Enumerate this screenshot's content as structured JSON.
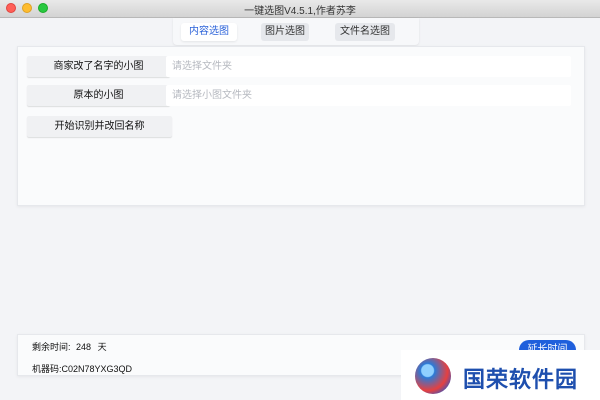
{
  "window": {
    "title": "一键选图V4.5.1,作者苏李"
  },
  "tabs": [
    {
      "label": "内容选图"
    },
    {
      "label": "图片选图"
    },
    {
      "label": "文件名选图"
    }
  ],
  "form": {
    "row1": {
      "button_label": "商家改了名字的小图",
      "placeholder": "请选择文件夹"
    },
    "row2": {
      "button_label": "原本的小图",
      "placeholder": "请选择小图文件夹"
    },
    "start_label": "开始识别并改回名称"
  },
  "footer": {
    "remaining_label": "剩余时间:",
    "remaining_value": "248",
    "remaining_unit": "天",
    "machine_label": "机器码:",
    "machine_code": "C02N78YXG3QD",
    "extend_label": "延长时间"
  },
  "watermark": {
    "text": "国荣软件园"
  },
  "colors": {
    "accent": "#1f5fdc",
    "tab_active_text": "#2b62d9"
  }
}
